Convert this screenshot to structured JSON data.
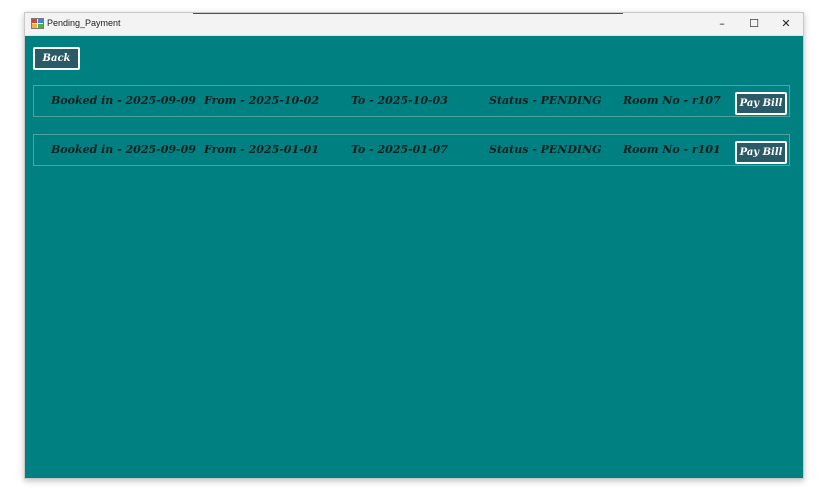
{
  "window": {
    "title": "Pending_Payment",
    "minimize_glyph": "–",
    "maximize_glyph": "☐",
    "close_glyph": "✕"
  },
  "colors": {
    "background": "#008080",
    "button_fill": "#2b5a67",
    "button_border": "#ffffff",
    "text": "#0f1f1f"
  },
  "back_button": {
    "label": "Back"
  },
  "bookings": [
    {
      "booked_in": "Booked in - 2025-09-09",
      "from": "From - 2025-10-02",
      "to": "To - 2025-10-03",
      "status": "Status - PENDING",
      "room": "Room No - r107",
      "pay_label": "Pay Bill"
    },
    {
      "booked_in": "Booked in - 2025-09-09",
      "from": "From - 2025-01-01",
      "to": "To - 2025-01-07",
      "status": "Status - PENDING",
      "room": "Room No - r101",
      "pay_label": "Pay Bill"
    }
  ]
}
